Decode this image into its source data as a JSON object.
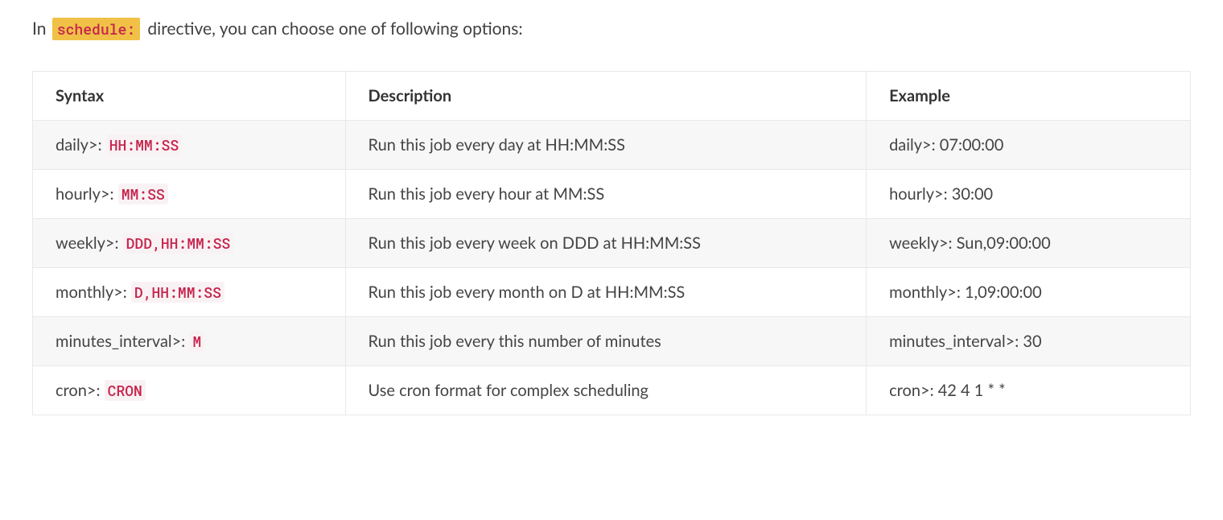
{
  "intro": {
    "prefix": "In ",
    "highlight": "schedule:",
    "suffix": " directive, you can choose one of following options:"
  },
  "table": {
    "headers": [
      "Syntax",
      "Description",
      "Example"
    ],
    "rows": [
      {
        "syntax_prefix": "daily>: ",
        "syntax_code": "HH:MM:SS",
        "description": "Run this job every day at HH:MM:SS",
        "example": "daily>: 07:00:00"
      },
      {
        "syntax_prefix": "hourly>: ",
        "syntax_code": "MM:SS",
        "description": "Run this job every hour at MM:SS",
        "example": "hourly>: 30:00"
      },
      {
        "syntax_prefix": "weekly>: ",
        "syntax_code": "DDD,HH:MM:SS",
        "description": "Run this job every week on DDD at HH:MM:SS",
        "example": "weekly>: Sun,09:00:00"
      },
      {
        "syntax_prefix": "monthly>: ",
        "syntax_code": "D,HH:MM:SS",
        "description": "Run this job every month on D at HH:MM:SS",
        "example": "monthly>: 1,09:00:00"
      },
      {
        "syntax_prefix": "minutes_interval>: ",
        "syntax_code": "M",
        "description": "Run this job every this number of minutes",
        "example": "minutes_interval>: 30"
      },
      {
        "syntax_prefix": "cron>: ",
        "syntax_code": "CRON",
        "description": "Use cron format for complex scheduling",
        "example": "cron>: 42 4 1 * *"
      }
    ]
  }
}
